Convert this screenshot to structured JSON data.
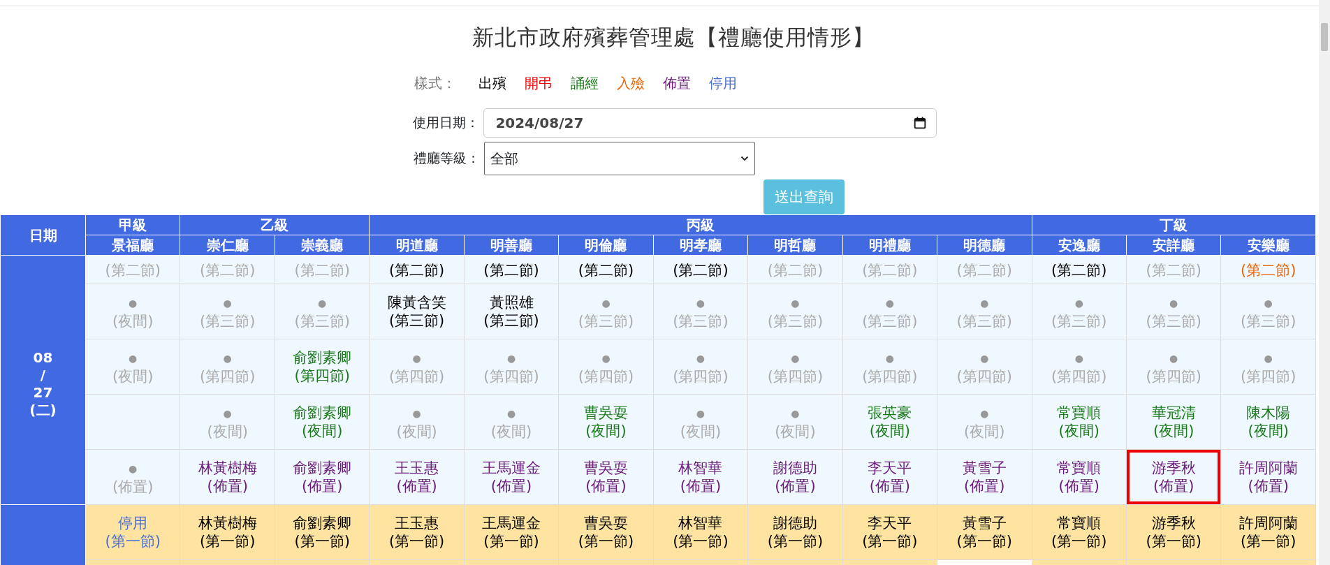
{
  "page": {
    "title": "新北市政府殯葬管理處【禮廳使用情形】"
  },
  "legend": {
    "label": "樣式：",
    "items": [
      {
        "label": "出殯",
        "kind": "funeral"
      },
      {
        "label": "開弔",
        "kind": "memorial"
      },
      {
        "label": "誦經",
        "kind": "sutra"
      },
      {
        "label": "入殮",
        "kind": "encoffin"
      },
      {
        "label": "佈置",
        "kind": "setup"
      },
      {
        "label": "停用",
        "kind": "disabled"
      }
    ]
  },
  "form": {
    "date_label": "使用日期：",
    "date_value": "2024/08/27",
    "level_label": "禮廳等級：",
    "level_value": "全部",
    "submit": "送出查詢"
  },
  "table": {
    "date_header": "日期",
    "groups": [
      {
        "label": "甲級",
        "halls": [
          "景福廳"
        ]
      },
      {
        "label": "乙級",
        "halls": [
          "崇仁廳",
          "崇義廳"
        ]
      },
      {
        "label": "丙級",
        "halls": [
          "明道廳",
          "明善廳",
          "明倫廳",
          "明孝廳",
          "明哲廳",
          "明禮廳",
          "明德廳"
        ]
      },
      {
        "label": "丁級",
        "halls": [
          "安逸廳",
          "安詳廳",
          "安樂廳"
        ]
      }
    ],
    "date_blocks": [
      {
        "kind": "first",
        "date_lines": [
          "08",
          "/",
          "27",
          "(二)"
        ],
        "rows": [
          {
            "kind": "cut",
            "cells": [
              {
                "slot": "(第二節)",
                "kind": "vacant",
                "highlighted": false
              },
              {
                "slot": "(第二節)",
                "kind": "vacant",
                "highlighted": false
              },
              {
                "slot": "(第二節)",
                "kind": "vacant",
                "highlighted": false
              },
              {
                "slot": "(第二節)",
                "kind": "funeral",
                "highlighted": false
              },
              {
                "slot": "(第二節)",
                "kind": "funeral",
                "highlighted": false
              },
              {
                "slot": "(第二節)",
                "kind": "funeral",
                "highlighted": false
              },
              {
                "slot": "(第二節)",
                "kind": "funeral",
                "highlighted": false
              },
              {
                "slot": "(第二節)",
                "kind": "vacant",
                "highlighted": false
              },
              {
                "slot": "(第二節)",
                "kind": "vacant",
                "highlighted": false
              },
              {
                "slot": "(第二節)",
                "kind": "vacant",
                "highlighted": false
              },
              {
                "slot": "(第二節)",
                "kind": "funeral",
                "highlighted": false
              },
              {
                "slot": "(第二節)",
                "kind": "vacant",
                "highlighted": false
              },
              {
                "slot": "(第二節)",
                "kind": "encoffin",
                "highlighted": false
              }
            ]
          },
          {
            "kind": "full",
            "cells": [
              {
                "name": "●",
                "slot": "(夜間)",
                "kind": "vacant",
                "highlighted": false
              },
              {
                "name": "●",
                "slot": "(第三節)",
                "kind": "vacant",
                "highlighted": false
              },
              {
                "name": "●",
                "slot": "(第三節)",
                "kind": "vacant",
                "highlighted": false
              },
              {
                "name": "陳黃含笑",
                "slot": "(第三節)",
                "kind": "funeral",
                "highlighted": false
              },
              {
                "name": "黃照雄",
                "slot": "(第三節)",
                "kind": "funeral",
                "highlighted": false
              },
              {
                "name": "●",
                "slot": "(第三節)",
                "kind": "vacant",
                "highlighted": false
              },
              {
                "name": "●",
                "slot": "(第三節)",
                "kind": "vacant",
                "highlighted": false
              },
              {
                "name": "●",
                "slot": "(第三節)",
                "kind": "vacant",
                "highlighted": false
              },
              {
                "name": "●",
                "slot": "(第三節)",
                "kind": "vacant",
                "highlighted": false
              },
              {
                "name": "●",
                "slot": "(第三節)",
                "kind": "vacant",
                "highlighted": false
              },
              {
                "name": "●",
                "slot": "(第三節)",
                "kind": "vacant",
                "highlighted": false
              },
              {
                "name": "●",
                "slot": "(第三節)",
                "kind": "vacant",
                "highlighted": false
              },
              {
                "name": "●",
                "slot": "(第三節)",
                "kind": "vacant",
                "highlighted": false
              }
            ]
          },
          {
            "kind": "full",
            "cells": [
              {
                "name": "●",
                "slot": "(夜間)",
                "kind": "vacant",
                "highlighted": false
              },
              {
                "name": "●",
                "slot": "(第四節)",
                "kind": "vacant",
                "highlighted": false
              },
              {
                "name": "俞劉素卿",
                "slot": "(第四節)",
                "kind": "sutra",
                "highlighted": false
              },
              {
                "name": "●",
                "slot": "(第四節)",
                "kind": "vacant",
                "highlighted": false
              },
              {
                "name": "●",
                "slot": "(第四節)",
                "kind": "vacant",
                "highlighted": false
              },
              {
                "name": "●",
                "slot": "(第四節)",
                "kind": "vacant",
                "highlighted": false
              },
              {
                "name": "●",
                "slot": "(第四節)",
                "kind": "vacant",
                "highlighted": false
              },
              {
                "name": "●",
                "slot": "(第四節)",
                "kind": "vacant",
                "highlighted": false
              },
              {
                "name": "●",
                "slot": "(第四節)",
                "kind": "vacant",
                "highlighted": false
              },
              {
                "name": "●",
                "slot": "(第四節)",
                "kind": "vacant",
                "highlighted": false
              },
              {
                "name": "●",
                "slot": "(第四節)",
                "kind": "vacant",
                "highlighted": false
              },
              {
                "name": "●",
                "slot": "(第四節)",
                "kind": "vacant",
                "highlighted": false
              },
              {
                "name": "●",
                "slot": "(第四節)",
                "kind": "vacant",
                "highlighted": false
              }
            ]
          },
          {
            "kind": "full",
            "cells": [
              {
                "kind": "empty",
                "highlighted": false
              },
              {
                "name": "●",
                "slot": "(夜間)",
                "kind": "vacant",
                "highlighted": false
              },
              {
                "name": "俞劉素卿",
                "slot": "(夜間)",
                "kind": "sutra",
                "highlighted": false
              },
              {
                "name": "●",
                "slot": "(夜間)",
                "kind": "vacant",
                "highlighted": false
              },
              {
                "name": "●",
                "slot": "(夜間)",
                "kind": "vacant",
                "highlighted": false
              },
              {
                "name": "曹吳耍",
                "slot": "(夜間)",
                "kind": "sutra",
                "highlighted": false
              },
              {
                "name": "●",
                "slot": "(夜間)",
                "kind": "vacant",
                "highlighted": false
              },
              {
                "name": "●",
                "slot": "(夜間)",
                "kind": "vacant",
                "highlighted": false
              },
              {
                "name": "張英豪",
                "slot": "(夜間)",
                "kind": "sutra",
                "highlighted": false
              },
              {
                "name": "●",
                "slot": "(夜間)",
                "kind": "vacant",
                "highlighted": false
              },
              {
                "name": "常寶順",
                "slot": "(夜間)",
                "kind": "sutra",
                "highlighted": false
              },
              {
                "name": "華冠清",
                "slot": "(夜間)",
                "kind": "sutra",
                "highlighted": false
              },
              {
                "name": "陳木陽",
                "slot": "(夜間)",
                "kind": "sutra",
                "highlighted": false
              }
            ]
          },
          {
            "kind": "full",
            "cells": [
              {
                "name": "●",
                "slot": "(佈置)",
                "kind": "vacant",
                "highlighted": false
              },
              {
                "name": "林黃樹梅",
                "slot": "(佈置)",
                "kind": "setup",
                "highlighted": false
              },
              {
                "name": "俞劉素卿",
                "slot": "(佈置)",
                "kind": "setup",
                "highlighted": false
              },
              {
                "name": "王玉惠",
                "slot": "(佈置)",
                "kind": "setup",
                "highlighted": false
              },
              {
                "name": "王馬運金",
                "slot": "(佈置)",
                "kind": "setup",
                "highlighted": false
              },
              {
                "name": "曹吳耍",
                "slot": "(佈置)",
                "kind": "setup",
                "highlighted": false
              },
              {
                "name": "林智華",
                "slot": "(佈置)",
                "kind": "setup",
                "highlighted": false
              },
              {
                "name": "謝德助",
                "slot": "(佈置)",
                "kind": "setup",
                "highlighted": false
              },
              {
                "name": "李天平",
                "slot": "(佈置)",
                "kind": "setup",
                "highlighted": false
              },
              {
                "name": "黃雪子",
                "slot": "(佈置)",
                "kind": "setup",
                "highlighted": false
              },
              {
                "name": "常寶順",
                "slot": "(佈置)",
                "kind": "setup",
                "highlighted": false
              },
              {
                "name": "游季秋",
                "slot": "(佈置)",
                "kind": "setup",
                "highlighted": true
              },
              {
                "name": "許周阿蘭",
                "slot": "(佈置)",
                "kind": "setup",
                "highlighted": false
              }
            ]
          }
        ]
      },
      {
        "kind": "second",
        "rows": [
          {
            "kind": "full",
            "cells": [
              {
                "name": "停用",
                "slot": "(第一節)",
                "kind": "disabled",
                "highlighted": false
              },
              {
                "name": "林黃樹梅",
                "slot": "(第一節)",
                "kind": "funeral",
                "highlighted": false
              },
              {
                "name": "俞劉素卿",
                "slot": "(第一節)",
                "kind": "funeral",
                "highlighted": false
              },
              {
                "name": "王玉惠",
                "slot": "(第一節)",
                "kind": "funeral",
                "highlighted": false
              },
              {
                "name": "王馬運金",
                "slot": "(第一節)",
                "kind": "funeral",
                "highlighted": false
              },
              {
                "name": "曹吳耍",
                "slot": "(第一節)",
                "kind": "funeral",
                "highlighted": false
              },
              {
                "name": "林智華",
                "slot": "(第一節)",
                "kind": "funeral",
                "highlighted": false
              },
              {
                "name": "謝德助",
                "slot": "(第一節)",
                "kind": "funeral",
                "highlighted": false
              },
              {
                "name": "李天平",
                "slot": "(第一節)",
                "kind": "funeral",
                "highlighted": false
              },
              {
                "name": "黃雪子",
                "slot": "(第一節)",
                "kind": "funeral",
                "highlighted": false
              },
              {
                "name": "常寶順",
                "slot": "(第一節)",
                "kind": "funeral",
                "highlighted": false
              },
              {
                "name": "游季秋",
                "slot": "(第一節)",
                "kind": "funeral",
                "highlighted": false
              },
              {
                "name": "許周阿蘭",
                "slot": "(第一節)",
                "kind": "funeral",
                "highlighted": false
              }
            ]
          },
          {
            "kind": "stub",
            "cells": [
              {
                "kind": "empty",
                "highlighted": false
              },
              {
                "kind": "empty",
                "highlighted": false
              },
              {
                "kind": "empty",
                "highlighted": false
              },
              {
                "kind": "empty",
                "highlighted": false
              },
              {
                "kind": "empty",
                "highlighted": false
              },
              {
                "kind": "empty",
                "highlighted": false
              },
              {
                "kind": "empty",
                "highlighted": false
              },
              {
                "kind": "empty",
                "highlighted": false
              },
              {
                "kind": "empty",
                "highlighted": false
              },
              {
                "kind": "blank",
                "highlighted": false
              },
              {
                "kind": "empty",
                "highlighted": false
              },
              {
                "kind": "empty",
                "highlighted": false
              },
              {
                "kind": "empty",
                "highlighted": false
              }
            ]
          }
        ]
      }
    ]
  }
}
